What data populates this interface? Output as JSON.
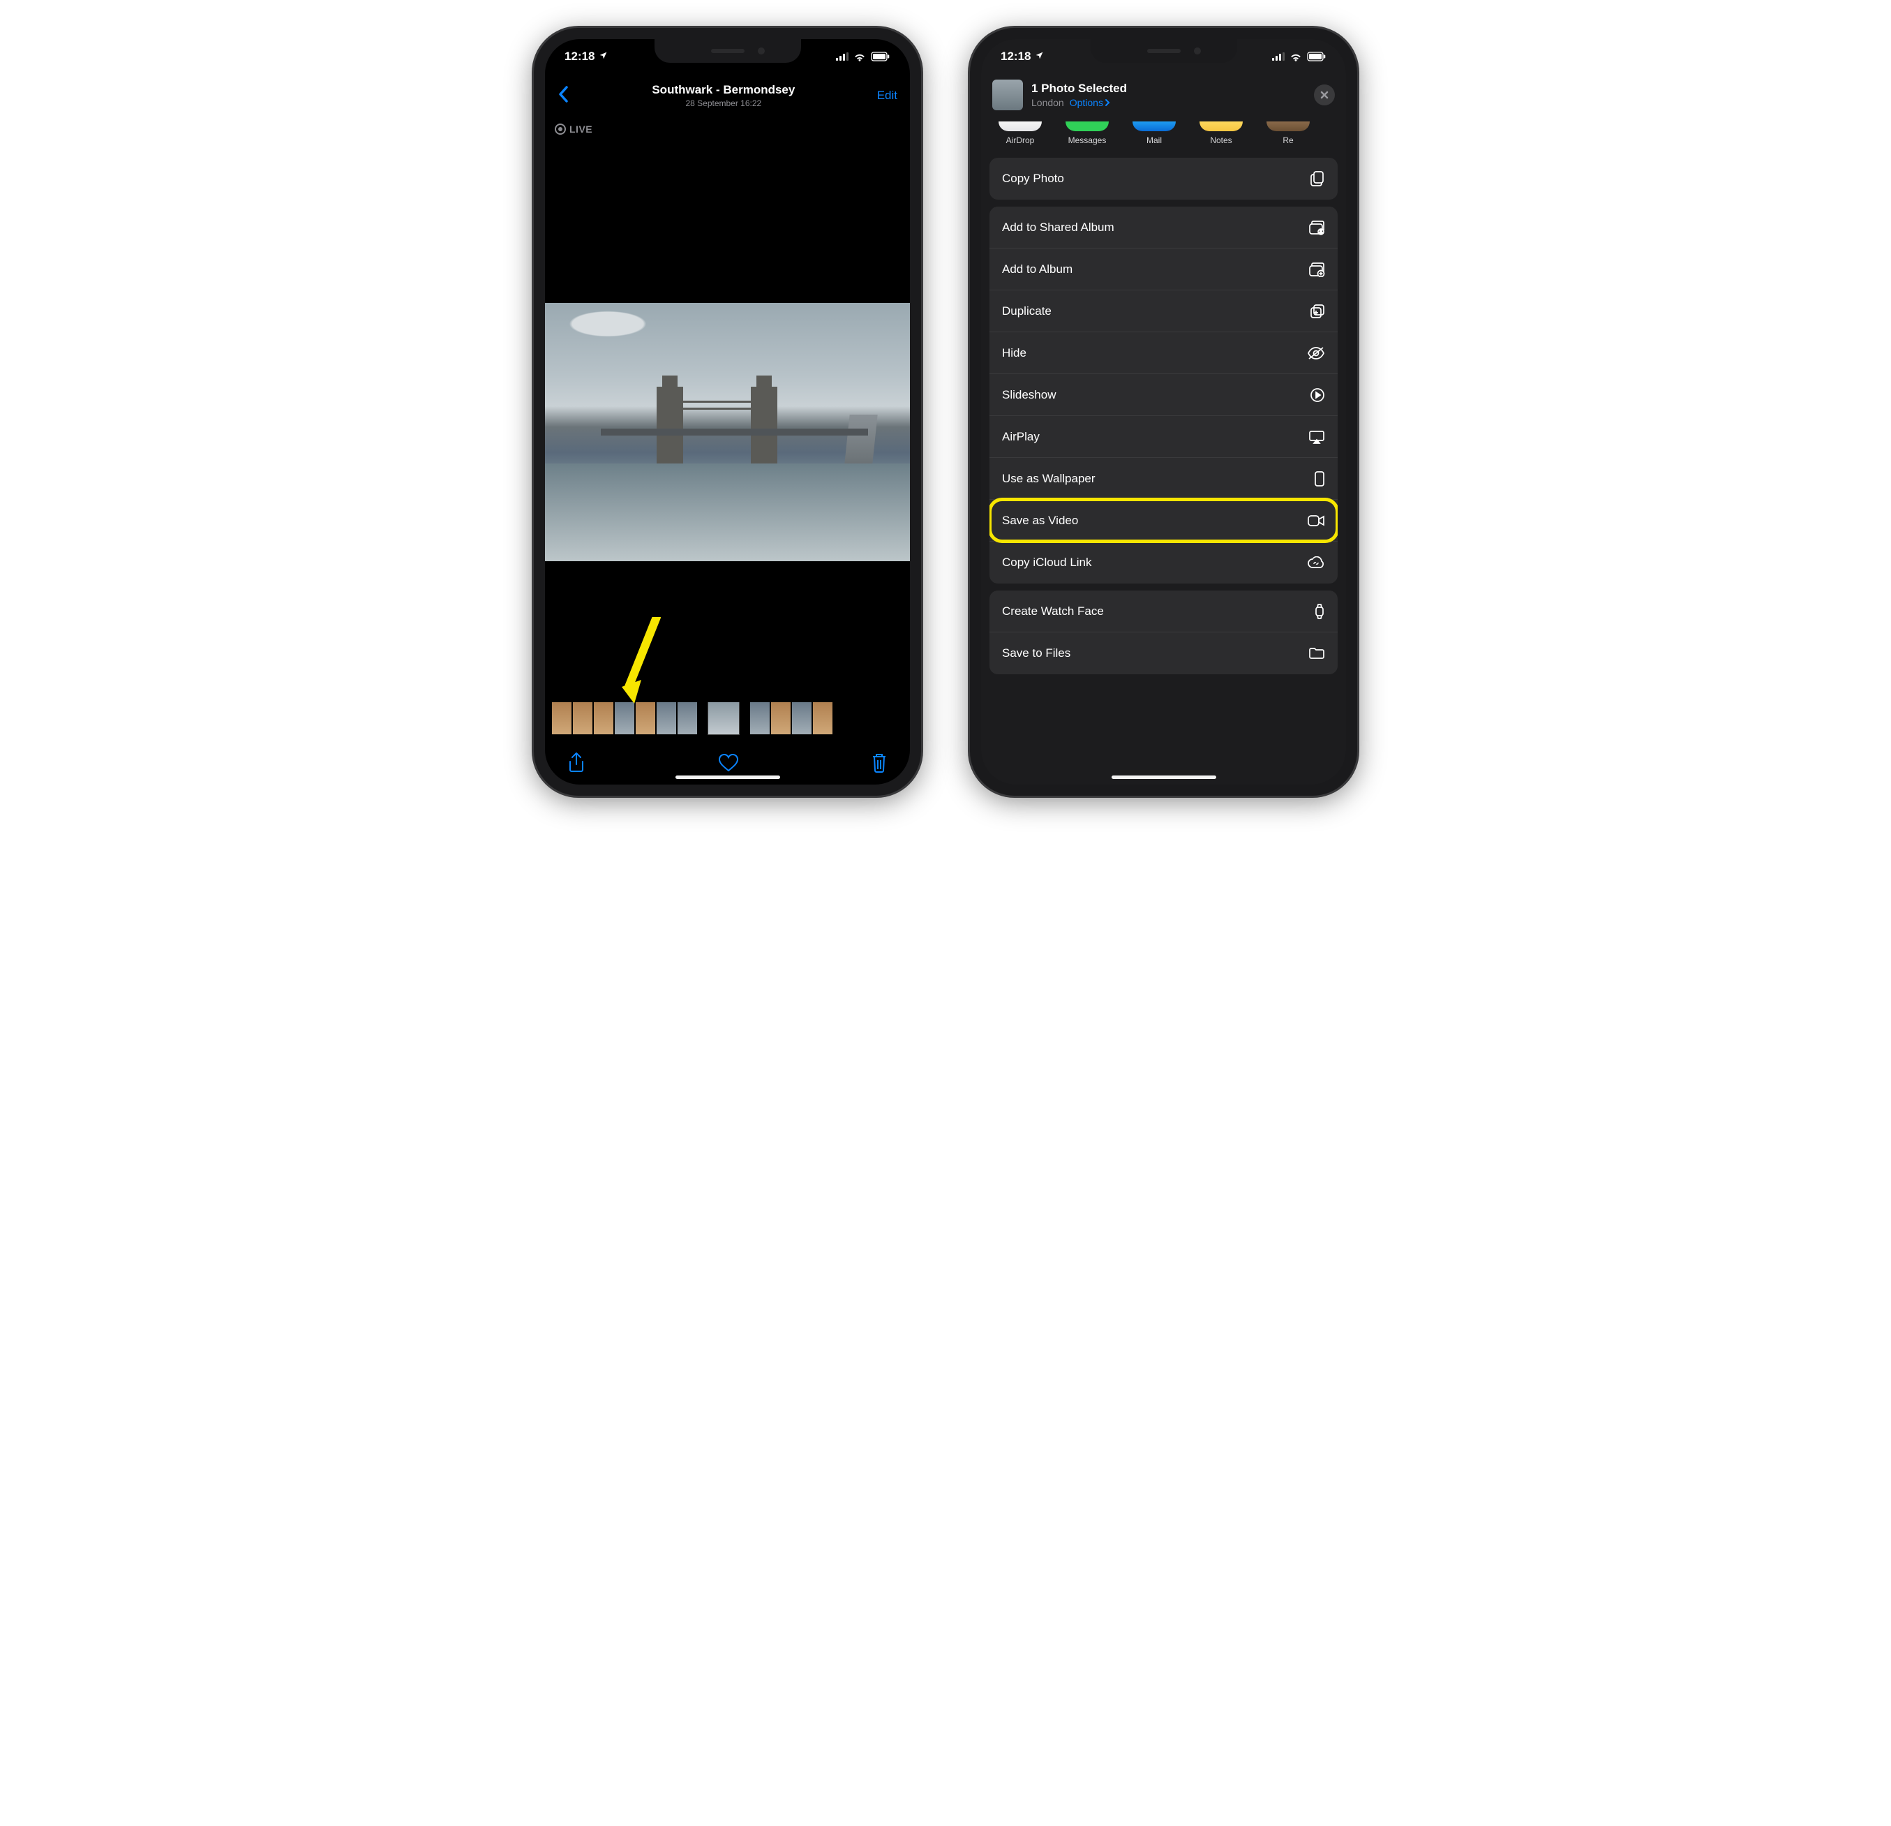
{
  "status": {
    "time": "12:18"
  },
  "phone1": {
    "header_title": "Southwark - Bermondsey",
    "header_subtitle": "28 September  16:22",
    "edit": "Edit",
    "live_badge": "LIVE"
  },
  "phone2": {
    "share_title": "1 Photo Selected",
    "share_location": "London",
    "share_options": "Options",
    "apps": [
      "AirDrop",
      "Messages",
      "Mail",
      "Notes",
      "Re"
    ],
    "group1": [
      "Copy Photo"
    ],
    "group2": [
      "Add to Shared Album",
      "Add to Album",
      "Duplicate",
      "Hide",
      "Slideshow",
      "AirPlay",
      "Use as Wallpaper",
      "Save as Video",
      "Copy iCloud Link"
    ],
    "group3": [
      "Create Watch Face",
      "Save to Files"
    ]
  }
}
